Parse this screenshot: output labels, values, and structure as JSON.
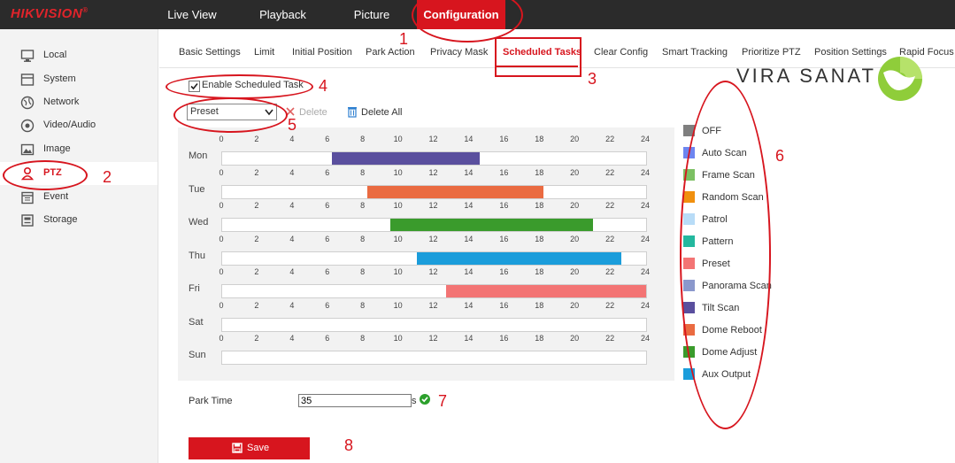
{
  "brand": {
    "logo": "HIKVISION",
    "reg": "®"
  },
  "nav": [
    "Live View",
    "Playback",
    "Picture",
    "Configuration"
  ],
  "sidebar": {
    "items": [
      {
        "label": "Local",
        "icon": "monitor-icon"
      },
      {
        "label": "System",
        "icon": "system-icon"
      },
      {
        "label": "Network",
        "icon": "globe-icon"
      },
      {
        "label": "Video/Audio",
        "icon": "video-audio-icon"
      },
      {
        "label": "Image",
        "icon": "image-icon"
      },
      {
        "label": "PTZ",
        "icon": "ptz-icon"
      },
      {
        "label": "Event",
        "icon": "calendar-icon"
      },
      {
        "label": "Storage",
        "icon": "storage-icon"
      }
    ]
  },
  "tabs": [
    "Basic Settings",
    "Limit",
    "Initial Position",
    "Park Action",
    "Privacy Mask",
    "Scheduled Tasks",
    "Clear Config",
    "Smart Tracking",
    "Prioritize PTZ",
    "Position Settings",
    "Rapid Focus"
  ],
  "watermark": "VIRA SANAT",
  "enable_label": "Enable Scheduled Task",
  "task_select": {
    "selected": "Preset"
  },
  "actions": {
    "delete": "Delete",
    "delete_all": "Delete All"
  },
  "schedule": {
    "hours": [
      "0",
      "2",
      "4",
      "6",
      "8",
      "10",
      "12",
      "14",
      "16",
      "18",
      "20",
      "22",
      "24"
    ],
    "days": [
      {
        "name": "Mon",
        "segments": [
          {
            "start": 6.2,
            "end": 14.6,
            "task": "Tilt Scan"
          }
        ]
      },
      {
        "name": "Tue",
        "segments": [
          {
            "start": 8.2,
            "end": 18.2,
            "task": "Dome Reboot"
          }
        ]
      },
      {
        "name": "Wed",
        "segments": [
          {
            "start": 9.5,
            "end": 21,
            "task": "Dome Adjust"
          }
        ]
      },
      {
        "name": "Thu",
        "segments": [
          {
            "start": 11,
            "end": 22.6,
            "task": "Aux Output"
          }
        ]
      },
      {
        "name": "Fri",
        "segments": [
          {
            "start": 12.7,
            "end": 24,
            "task": "Preset"
          }
        ]
      },
      {
        "name": "Sat",
        "segments": []
      },
      {
        "name": "Sun",
        "segments": []
      }
    ]
  },
  "legend": [
    {
      "label": "OFF",
      "color": "#7f7f7f"
    },
    {
      "label": "Auto Scan",
      "color": "#6d85f0"
    },
    {
      "label": "Frame Scan",
      "color": "#7cc063"
    },
    {
      "label": "Random Scan",
      "color": "#f0900f"
    },
    {
      "label": "Patrol",
      "color": "#b8dcf7"
    },
    {
      "label": "Pattern",
      "color": "#23b89e"
    },
    {
      "label": "Preset",
      "color": "#f37474"
    },
    {
      "label": "Panorama Scan",
      "color": "#8b98cc"
    },
    {
      "label": "Tilt Scan",
      "color": "#5a4f9e"
    },
    {
      "label": "Dome Reboot",
      "color": "#ea6b41"
    },
    {
      "label": "Dome Adjust",
      "color": "#3a9b2c"
    },
    {
      "label": "Aux Output",
      "color": "#1b9ddb"
    }
  ],
  "park_time": {
    "label": "Park Time",
    "value": "35",
    "unit": "s"
  },
  "save_label": "Save",
  "annotations": [
    "1",
    "2",
    "3",
    "4",
    "5",
    "6",
    "7",
    "8"
  ]
}
